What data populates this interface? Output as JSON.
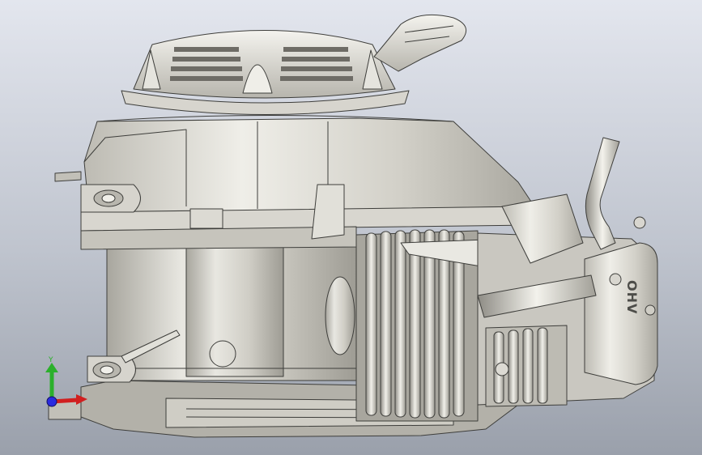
{
  "viewport": {
    "background_top": "#e3e6ee",
    "background_bottom": "#9aa0ab"
  },
  "model": {
    "material_color": "#c9c7c0",
    "edge_color": "#3e3e3b",
    "highlight_color": "#f2f1ec",
    "shadow_color": "#8c8a83",
    "cylinder_head_stamp": "OHV"
  },
  "triad": {
    "y_label": "Y",
    "x_color": "#d11f1f",
    "y_color": "#2bb02b",
    "z_color": "#2a2ae0"
  }
}
